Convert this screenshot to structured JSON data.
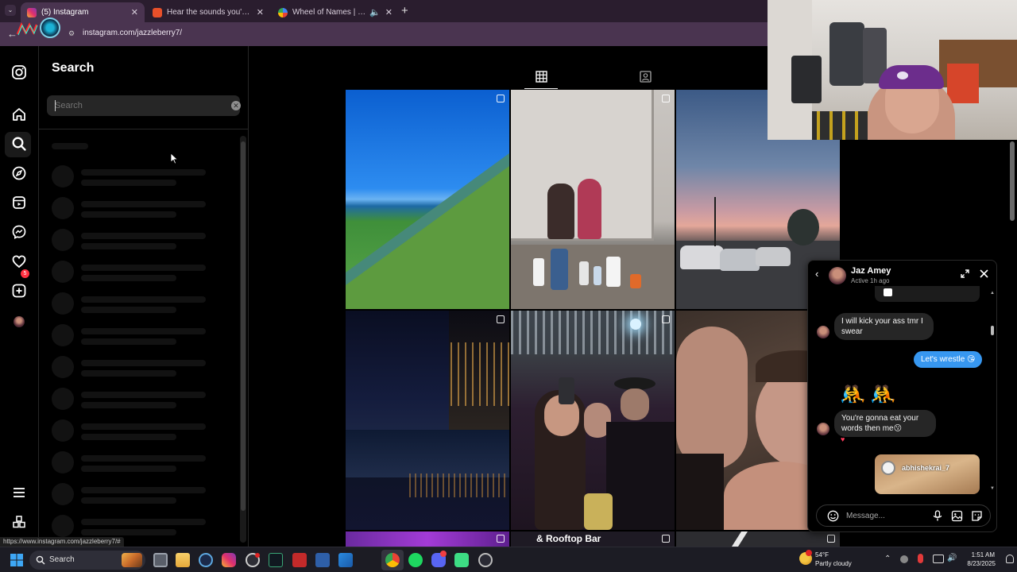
{
  "browser": {
    "tabs": [
      {
        "label": "(5) Instagram",
        "active": true
      },
      {
        "label": "Hear the sounds you've recently",
        "active": false
      },
      {
        "label": "Wheel of Names | Random",
        "active": false
      }
    ],
    "url": "instagram.com/jazzleberry7/"
  },
  "search_panel": {
    "title": "Search",
    "placeholder": "Search"
  },
  "sidebar": {
    "notification_count": "5"
  },
  "profile_grid": {
    "tabs": [
      "posts",
      "tagged"
    ],
    "overlay_text": "& Rooftop Bar"
  },
  "chat": {
    "name": "Jaz Amey",
    "status": "Active 1h ago",
    "messages": [
      {
        "from": "them",
        "text": "I will kick your ass tmr I swear"
      },
      {
        "from": "me",
        "text": "Let's wrestle 😘"
      },
      {
        "from": "them",
        "text": "🤼🤼"
      },
      {
        "from": "them",
        "text": "You're gonna eat your words then me😗"
      },
      {
        "from": "them",
        "text": "♥"
      }
    ],
    "shared_post_user": "abhishekrai_7",
    "input_placeholder": "Message..."
  },
  "status_url": "https://www.instagram.com/jazzleberry7/#",
  "taskbar": {
    "search_label": "Search",
    "weather_temp": "54°F",
    "weather_desc": "Partly cloudy",
    "time": "1:51 AM",
    "date": "8/23/2025"
  }
}
